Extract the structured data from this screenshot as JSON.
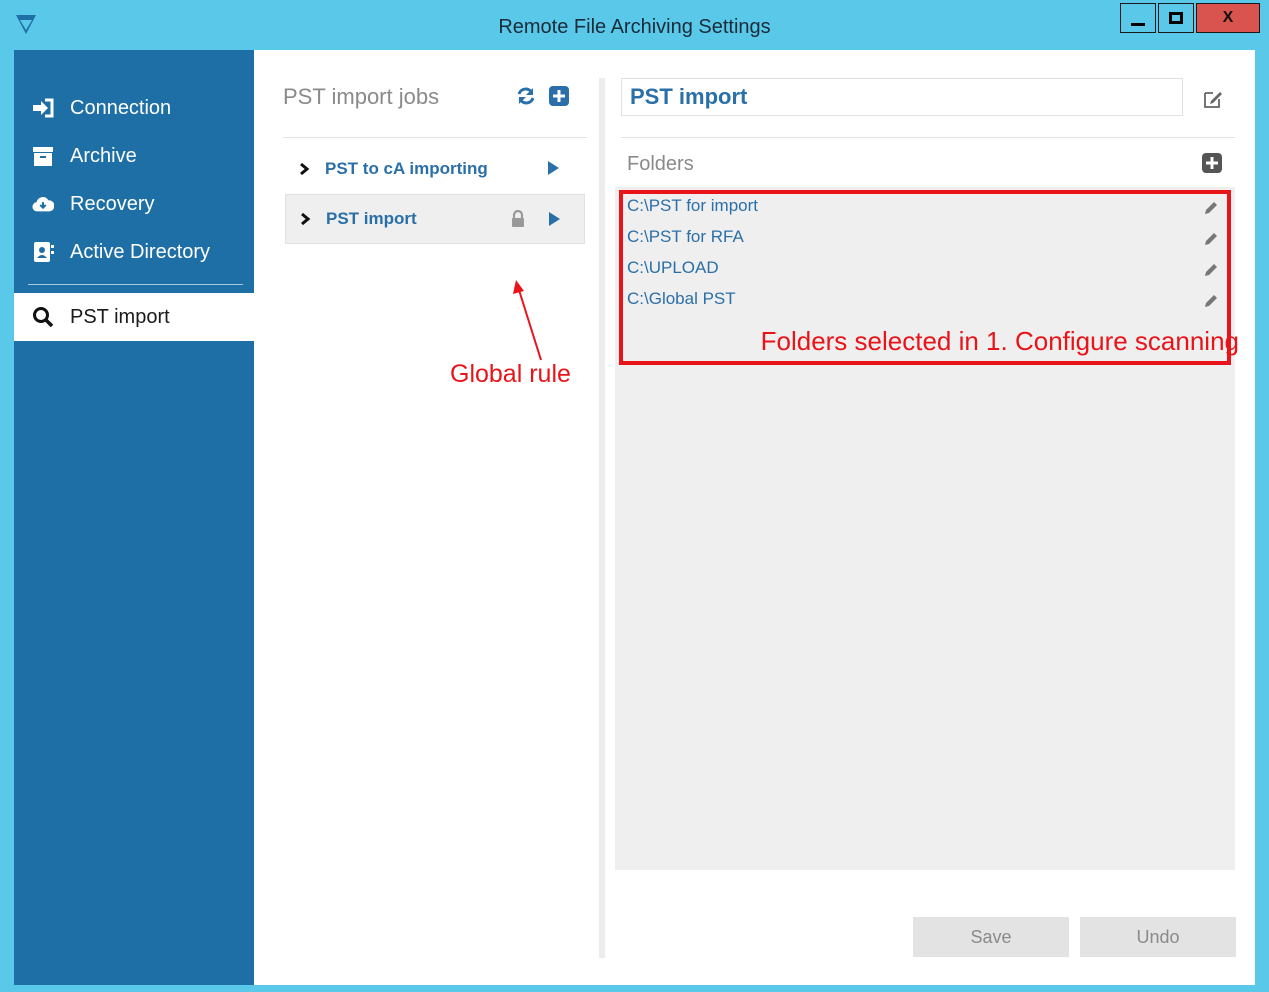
{
  "window": {
    "title": "Remote File Archiving Settings",
    "close_label": "X"
  },
  "sidebar": {
    "items": [
      {
        "label": "Connection",
        "icon": "sign-in-icon"
      },
      {
        "label": "Archive",
        "icon": "archive-icon"
      },
      {
        "label": "Recovery",
        "icon": "cloud-download-icon"
      },
      {
        "label": "Active Directory",
        "icon": "address-book-icon"
      },
      {
        "label": "PST import",
        "icon": "search-icon",
        "active": true
      }
    ]
  },
  "jobs": {
    "title": "PST import jobs",
    "items": [
      {
        "label": "PST to cA importing",
        "locked": false
      },
      {
        "label": "PST import",
        "locked": true,
        "selected": true
      }
    ]
  },
  "detail": {
    "name_value": "PST import",
    "folders_title": "Folders",
    "folders": [
      "C:\\PST for import",
      "C:\\PST for RFA",
      "C:\\UPLOAD",
      "C:\\Global PST"
    ],
    "save_label": "Save",
    "undo_label": "Undo"
  },
  "annotations": {
    "global_rule": "Global rule",
    "folders_note": "Folders selected in 1. Configure scanning"
  },
  "colors": {
    "titlebar": "#5ac8e8",
    "sidebar": "#1e6fa5",
    "link": "#2b6fa8",
    "annotation": "#e8141a",
    "close": "#d9534f"
  }
}
